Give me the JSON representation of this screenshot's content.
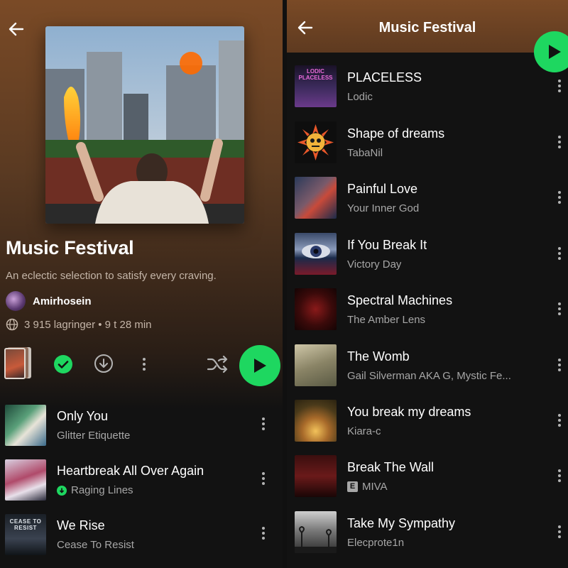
{
  "left": {
    "playlist": {
      "title": "Music Festival",
      "description": "An eclectic selection to satisfy every craving.",
      "owner": "Amirhosein",
      "stats": "3 915 lagringer • 9 t 28 min"
    },
    "tracks": [
      {
        "title": "Only You",
        "artist": "Glitter Etiquette",
        "downloaded": false
      },
      {
        "title": "Heartbreak All Over Again",
        "artist": "Raging Lines",
        "downloaded": true
      },
      {
        "title": "We Rise",
        "artist": "Cease To Resist",
        "downloaded": false
      }
    ]
  },
  "right": {
    "header_title": "Music Festival",
    "tracks": [
      {
        "title": "PLACELESS",
        "artist": "Lodic",
        "explicit": false,
        "art_text": "LODIC PLACELESS"
      },
      {
        "title": "Shape of dreams",
        "artist": "TabaNil",
        "explicit": false
      },
      {
        "title": "Painful Love",
        "artist": "Your Inner God",
        "explicit": false
      },
      {
        "title": "If You Break It",
        "artist": "Victory Day",
        "explicit": false
      },
      {
        "title": "Spectral Machines",
        "artist": "The Amber Lens",
        "explicit": false
      },
      {
        "title": "The Womb",
        "artist": "Gail Silverman AKA G, Mystic Fe...",
        "explicit": false
      },
      {
        "title": "You break my dreams",
        "artist": "Kiara-c",
        "explicit": false
      },
      {
        "title": "Break The Wall",
        "artist": "MIVA",
        "explicit": true
      },
      {
        "title": "Take My Sympathy",
        "artist": "Elecprote1n",
        "explicit": false
      }
    ]
  },
  "labels": {
    "explicit_badge": "E",
    "we_rise_art": "CEASE TO RESIST"
  },
  "colors": {
    "accent": "#1ed760",
    "header_brown": "#7a4a26",
    "background": "#121212",
    "secondary_text": "#a7a7a7"
  },
  "icons": [
    "back-arrow-icon",
    "check-circle-icon",
    "download-icon",
    "more-icon",
    "shuffle-icon",
    "play-icon"
  ]
}
